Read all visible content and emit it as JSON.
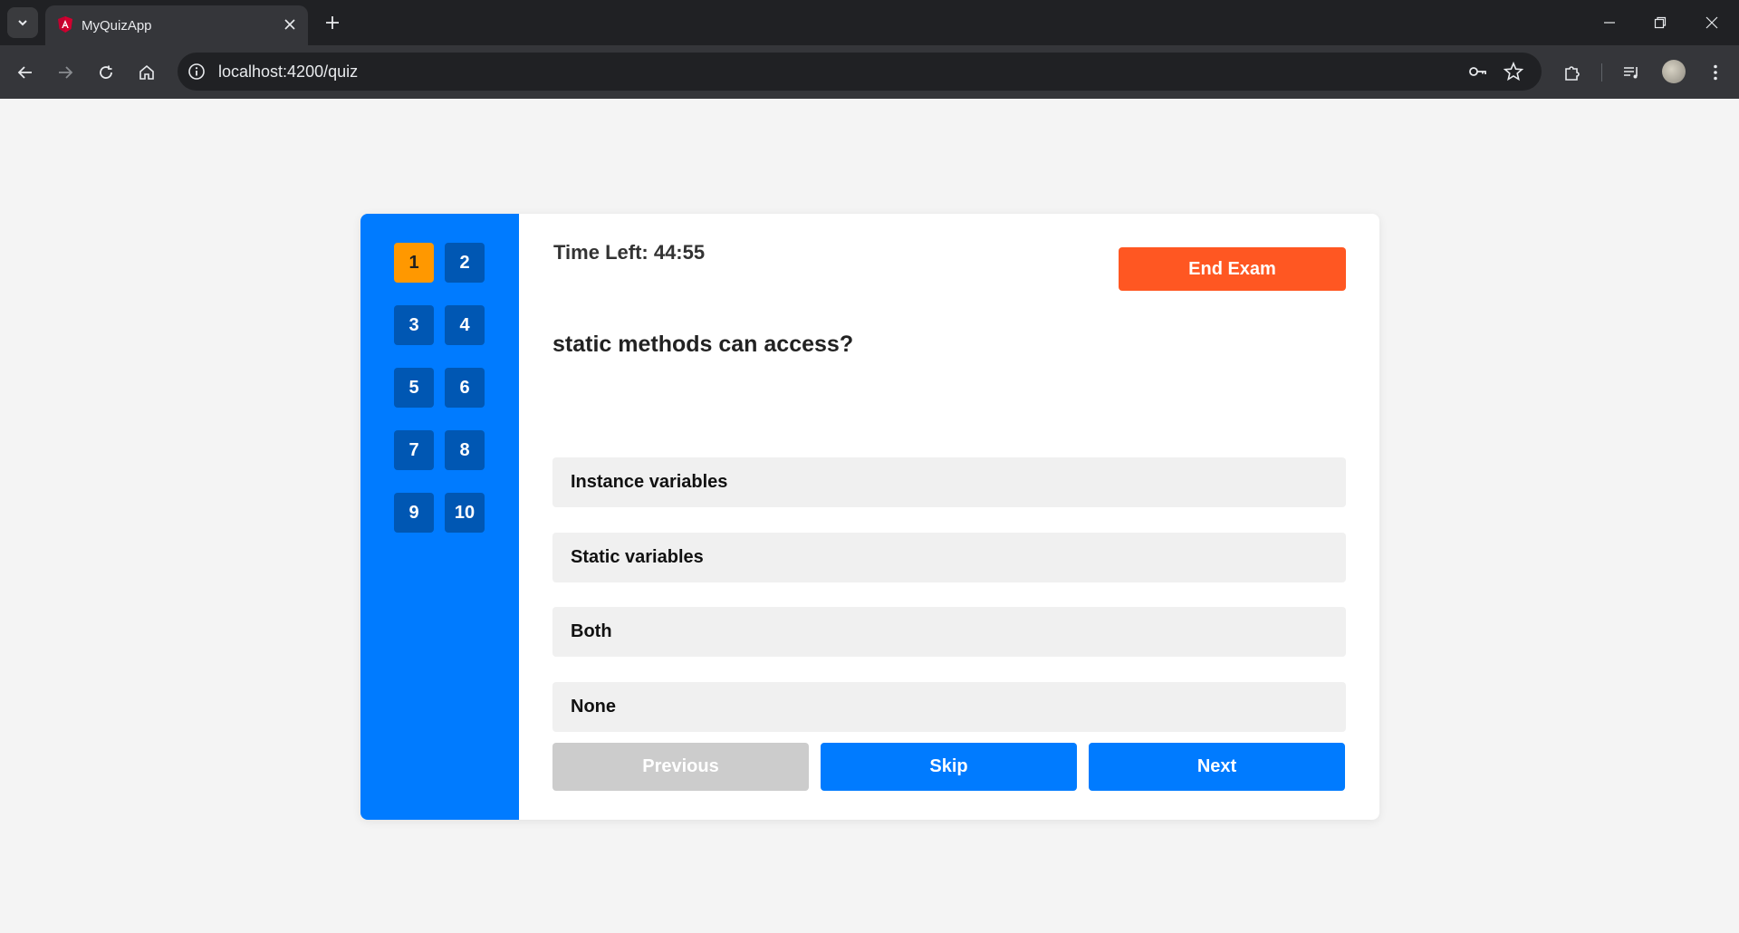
{
  "browser": {
    "tab_title": "MyQuizApp",
    "url": "localhost:4200/quiz",
    "icons": [
      "tab-search-icon",
      "angular-favicon",
      "close-icon",
      "plus-icon",
      "minimize-icon",
      "restore-icon",
      "close-window-icon",
      "back-arrow-icon",
      "forward-arrow-icon",
      "reload-icon",
      "home-icon",
      "site-info-icon",
      "password-key-icon",
      "star-icon",
      "extensions-icon",
      "media-control-icon",
      "profile-avatar",
      "more-vert-icon"
    ]
  },
  "quiz": {
    "timer_text": "Time Left: 44:55",
    "end_exam_label": "End Exam",
    "question_text": "static methods can access?",
    "question_numbers": [
      "1",
      "2",
      "3",
      "4",
      "5",
      "6",
      "7",
      "8",
      "9",
      "10"
    ],
    "active_question": "1",
    "options": [
      "Instance variables",
      "Static variables",
      "Both",
      "None"
    ],
    "actions": {
      "previous_label": "Previous",
      "skip_label": "Skip",
      "next_label": "Next"
    },
    "colors": {
      "sidebar": "#007bff",
      "question_button": "#0057b3",
      "active_question": "#ff9800",
      "end_exam": "#ff5722",
      "primary": "#007bff",
      "disabled": "#cccccc"
    }
  }
}
